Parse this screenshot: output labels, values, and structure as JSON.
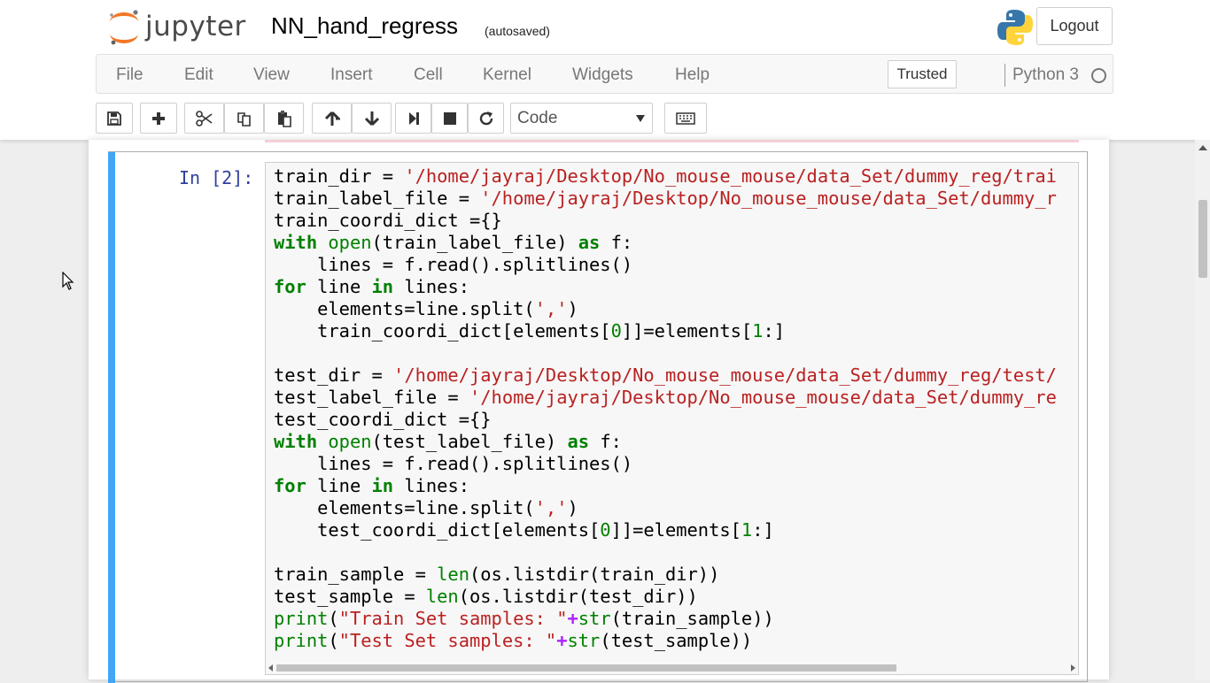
{
  "header": {
    "logo_text": "jupyter",
    "notebook_title": "NN_hand_regress",
    "autosave_status": "(autosaved)",
    "logout_label": "Logout"
  },
  "menubar": {
    "items": [
      "File",
      "Edit",
      "View",
      "Insert",
      "Cell",
      "Kernel",
      "Widgets",
      "Help"
    ],
    "trusted_label": "Trusted",
    "kernel_name": "Python 3"
  },
  "toolbar": {
    "buttons": [
      "save-icon",
      "plus-icon",
      "scissors-icon",
      "copy-icon",
      "paste-icon",
      "arrow-up-icon",
      "arrow-down-icon",
      "step-forward-icon",
      "stop-icon",
      "refresh-icon",
      "keyboard-icon"
    ],
    "cell_type": "Code"
  },
  "cell": {
    "prompt": "In [2]:",
    "code_lines": [
      "train_dir = '/home/jayraj/Desktop/No_mouse_mouse/data_Set/dummy_reg/trai",
      "train_label_file = '/home/jayraj/Desktop/No_mouse_mouse/data_Set/dummy_r",
      "train_coordi_dict ={}",
      "with open(train_label_file) as f:",
      "    lines = f.read().splitlines()",
      "for line in lines:",
      "    elements=line.split(',')",
      "    train_coordi_dict[elements[0]]=elements[1:]",
      "",
      "test_dir = '/home/jayraj/Desktop/No_mouse_mouse/data_Set/dummy_reg/test/",
      "test_label_file = '/home/jayraj/Desktop/No_mouse_mouse/data_Set/dummy_re",
      "test_coordi_dict ={}",
      "with open(test_label_file) as f:",
      "    lines = f.read().splitlines()",
      "for line in lines:",
      "    elements=line.split(',')",
      "    test_coordi_dict[elements[0]]=elements[1:]",
      "",
      "train_sample = len(os.listdir(train_dir))",
      "test_sample = len(os.listdir(test_dir))",
      "print(\"Train Set samples: \"+str(train_sample))",
      "print(\"Test Set samples: \"+str(test_sample))"
    ]
  },
  "colors": {
    "cell_selected_bar": "#42a5f5",
    "keyword": "#008000",
    "string": "#ba2121",
    "prompt": "#303f9f",
    "operator": "#aa22ff"
  }
}
